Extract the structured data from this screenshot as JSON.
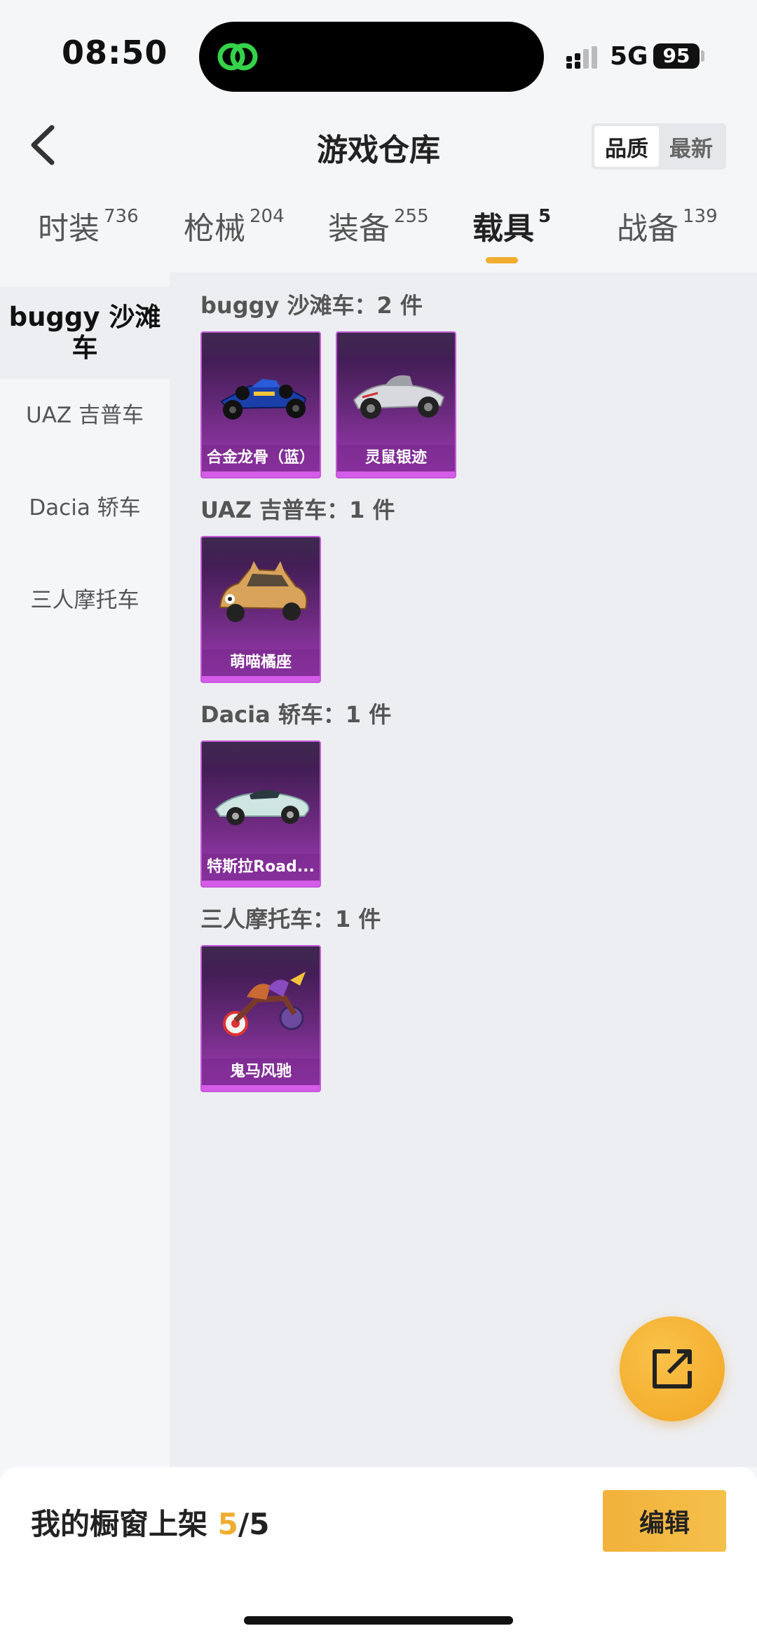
{
  "status_bar": {
    "time": "08:50",
    "network": "5G",
    "battery": "95"
  },
  "header": {
    "title": "游戏仓库",
    "sort_options": [
      "品质",
      "最新"
    ],
    "active_sort": "品质"
  },
  "tabs": [
    {
      "label": "时装",
      "count": "736"
    },
    {
      "label": "枪械",
      "count": "204"
    },
    {
      "label": "装备",
      "count": "255"
    },
    {
      "label": "载具",
      "count": "5",
      "active": true
    },
    {
      "label": "战备",
      "count": "139"
    }
  ],
  "sidebar": {
    "items": [
      {
        "label": "buggy 沙滩车",
        "active": true
      },
      {
        "label": "UAZ 吉普车"
      },
      {
        "label": "Dacia 轿车"
      },
      {
        "label": "三人摩托车"
      }
    ]
  },
  "groups": [
    {
      "title": "buggy 沙滩车：2 件",
      "items": [
        {
          "name": "合金龙骨（蓝）",
          "icon": "race-car-blue"
        },
        {
          "name": "灵鼠银迹",
          "icon": "buggy-silver"
        }
      ]
    },
    {
      "title": "UAZ 吉普车：1 件",
      "items": [
        {
          "name": "萌喵橘座",
          "icon": "cat-car-orange"
        }
      ]
    },
    {
      "title": "Dacia 轿车：1 件",
      "items": [
        {
          "name": "特斯拉Road...",
          "icon": "roadster-teal"
        }
      ]
    },
    {
      "title": "三人摩托车：1 件",
      "items": [
        {
          "name": "鬼马风驰",
          "icon": "motorbike-purple"
        }
      ]
    }
  ],
  "bottom_bar": {
    "label": "我的橱窗上架 ",
    "current": "5",
    "total": "/5",
    "edit_label": "编辑"
  },
  "colors": {
    "accent": "#f0ad2e",
    "card_purple": "#a23db8"
  }
}
